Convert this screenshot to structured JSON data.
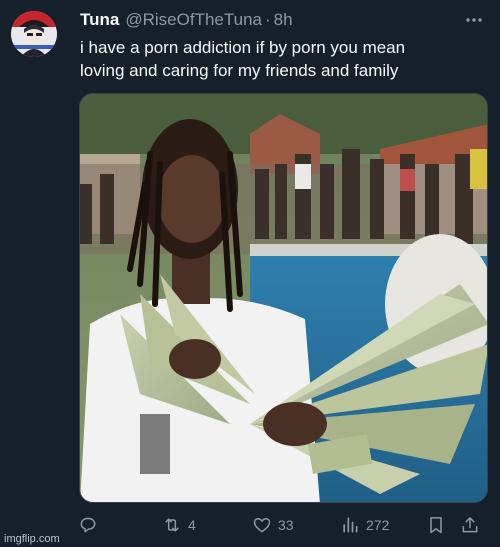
{
  "tweet": {
    "author": {
      "display_name": "Tuna",
      "handle": "@RiseOfTheTuna",
      "separator": "·",
      "timestamp": "8h"
    },
    "text_line1": "i have a porn addiction if by porn you mean",
    "text_line2": "loving and caring for my friends and family",
    "media": {
      "description": "photo: young man holding fanned-out stack of dollar bills by a pool party"
    },
    "actions": {
      "reply": {
        "icon": "reply-icon",
        "count": ""
      },
      "retweet": {
        "icon": "retweet-icon",
        "count": "4"
      },
      "like": {
        "icon": "heart-icon",
        "count": "33"
      },
      "views": {
        "icon": "views-icon",
        "count": "272"
      },
      "bookmark": {
        "icon": "bookmark-icon"
      },
      "share": {
        "icon": "share-icon"
      }
    }
  },
  "watermark": "imgflip.com",
  "colors": {
    "background": "#15202b",
    "text_primary": "#f7f9f9",
    "text_secondary": "#8b98a5",
    "border": "#38444d"
  }
}
